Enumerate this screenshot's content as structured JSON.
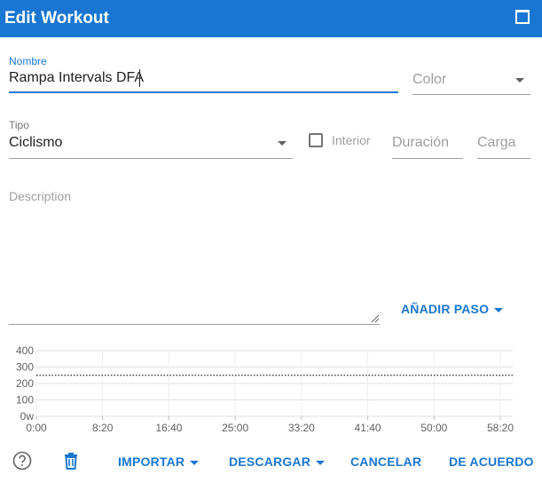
{
  "window": {
    "title": "Edit Workout"
  },
  "form": {
    "name": {
      "label": "Nombre",
      "value": "Rampa Intervals DFA"
    },
    "color": {
      "placeholder": "Color"
    },
    "type": {
      "label": "Tipo",
      "value": "Ciclismo"
    },
    "indoor": {
      "label": "Interior",
      "checked": false
    },
    "duration": {
      "placeholder": "Duración"
    },
    "load": {
      "placeholder": "Carga"
    },
    "description": {
      "placeholder": "Description"
    }
  },
  "add_step_label": "AÑADIR PASO",
  "chart_data": {
    "type": "line",
    "title": "",
    "xlabel": "",
    "ylabel": "",
    "y_ticks": [
      "0w",
      "100",
      "200",
      "300",
      "400"
    ],
    "x_ticks": [
      "0:00",
      "8:20",
      "16:40",
      "25:00",
      "33:20",
      "41:40",
      "50:00",
      "58:20"
    ],
    "ylim": [
      0,
      400
    ],
    "reference_line": {
      "value": 250,
      "style": "dotted"
    }
  },
  "footer": {
    "import_label": "IMPORTAR",
    "download_label": "DESCARGAR",
    "cancel_label": "CANCELAR",
    "ok_label": "DE ACUERDO"
  },
  "colors": {
    "primary": "#1976d2"
  }
}
